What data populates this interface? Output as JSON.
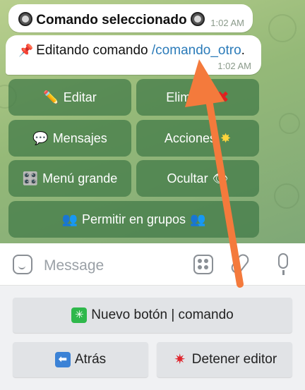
{
  "messages": [
    {
      "text": "Comando seleccionado",
      "time": "1:02 AM",
      "icon": "radio-button-icon"
    },
    {
      "text_prefix": "Editando comando ",
      "link": "/comando_otro",
      "text_suffix": ".",
      "time": "1:02 AM",
      "icon": "pushpin-icon"
    }
  ],
  "inline_keyboard": {
    "edit": {
      "label": "Editar",
      "icon": "pencil-icon"
    },
    "delete": {
      "label": "Eliminar",
      "icon": "cross-mark-icon"
    },
    "messages": {
      "label": "Mensajes",
      "icon": "speech-bubble-icon"
    },
    "actions": {
      "label": "Acciones",
      "icon": "sparkle-star-icon"
    },
    "big_menu": {
      "label": "Menú grande",
      "icon": "control-knobs-icon"
    },
    "hide": {
      "label": "Ocultar",
      "icon": "eye-icon"
    },
    "groups": {
      "label": "Permitir en grupos",
      "icon": "people-icon"
    }
  },
  "input": {
    "placeholder": "Message"
  },
  "reply_keyboard": {
    "new_button": {
      "label": "Nuevo botón | comando",
      "icon": "eight-spoked-asterisk-icon"
    },
    "back": {
      "label": "Atrás",
      "icon": "left-arrow-icon"
    },
    "stop": {
      "label": "Detener editor",
      "icon": "anger-symbol-icon"
    }
  },
  "colors": {
    "accent_link": "#2b7bb9",
    "annotation_arrow": "#f47a3c",
    "inline_button_bg": "#4f8a56"
  }
}
